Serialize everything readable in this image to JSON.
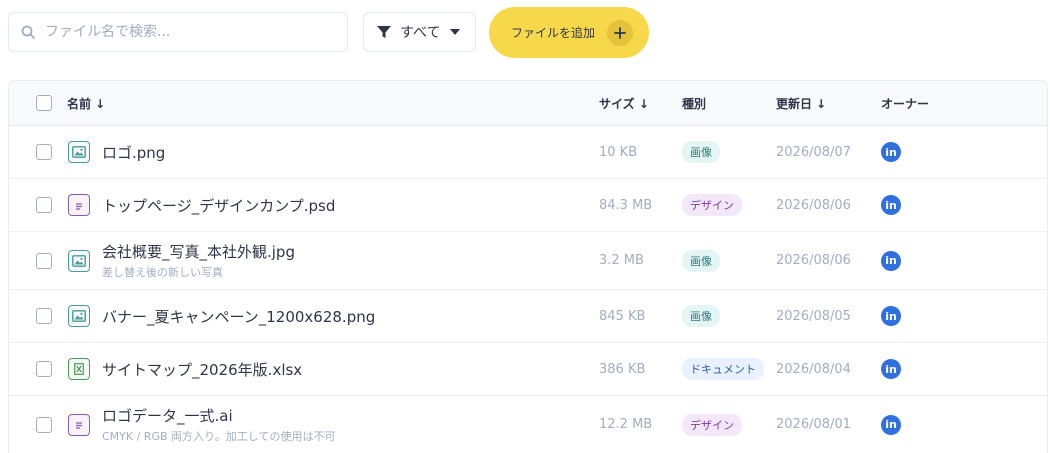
{
  "toolbar": {
    "search_placeholder": "ファイル名で検索...",
    "search_value": "",
    "search_icon": "search-icon",
    "filter_icon": "funnel-icon",
    "filter_label": "すべて",
    "add_label": "ファイルを追加"
  },
  "table": {
    "headers": {
      "name": "名前 ↓",
      "size": "サイズ ↓",
      "type": "種別",
      "updated": "更新日 ↓",
      "owner": "オーナー"
    },
    "rows": [
      {
        "name": "ロゴ.png",
        "sub": "",
        "icon": "image-file-icon",
        "size": "10 KB",
        "type": "画像",
        "type_kind": "image",
        "date": "2026/08/07",
        "owner": "in"
      },
      {
        "name": "トップページ_デザインカンプ.psd",
        "sub": "",
        "icon": "document-file-icon",
        "size": "84.3 MB",
        "type": "デザイン",
        "type_kind": "design",
        "date": "2026/08/06",
        "owner": "in"
      },
      {
        "name": "会社概要_写真_本社外観.jpg",
        "sub": "差し替え後の新しい写真",
        "icon": "image-file-icon",
        "size": "3.2 MB",
        "type": "画像",
        "type_kind": "image",
        "date": "2026/08/06",
        "owner": "in"
      },
      {
        "name": "バナー_夏キャンペーン_1200x628.png",
        "sub": "",
        "icon": "image-file-icon",
        "size": "845 KB",
        "type": "画像",
        "type_kind": "image",
        "date": "2026/08/05",
        "owner": "in"
      },
      {
        "name": "サイトマップ_2026年版.xlsx",
        "sub": "",
        "icon": "spreadsheet-file-icon",
        "size": "386 KB",
        "type": "ドキュメント",
        "type_kind": "document",
        "date": "2026/08/04",
        "owner": "in"
      },
      {
        "name": "ロゴデータ_一式.ai",
        "sub": "CMYK / RGB 両方入り。加工しての使用は不可",
        "icon": "document-file-icon",
        "size": "12.2 MB",
        "type": "デザイン",
        "type_kind": "design",
        "date": "2026/08/01",
        "owner": "in"
      }
    ]
  },
  "colors": {
    "accent": "#f7d84a",
    "owner_avatar": "#2f6fe0",
    "badge_image": "#e3f6f5",
    "badge_design": "#f3e8fa",
    "badge_document": "#e8f1fd"
  }
}
